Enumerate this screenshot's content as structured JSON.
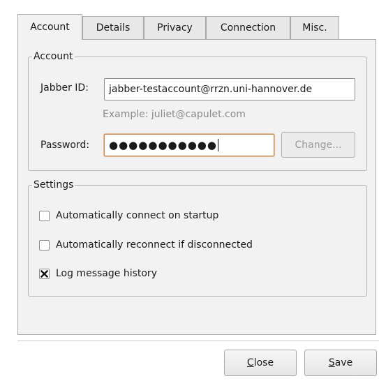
{
  "tabs": [
    {
      "label": "Account",
      "active": true
    },
    {
      "label": "Details",
      "active": false
    },
    {
      "label": "Privacy",
      "active": false
    },
    {
      "label": "Connection",
      "active": false
    },
    {
      "label": "Misc.",
      "active": false
    }
  ],
  "account": {
    "legend": "Account",
    "jabber_label": "Jabber ID:",
    "jabber_value": "jabber-testaccount@rrzn.uni-hannover.de",
    "example": "Example: juliet@capulet.com",
    "password_label": "Password:",
    "password_mask": "●●●●●●●●●●●",
    "change_label": "Change..."
  },
  "settings": {
    "legend": "Settings",
    "options": [
      {
        "label": "Automatically connect on startup",
        "checked": false
      },
      {
        "label": "Automatically reconnect if disconnected",
        "checked": false
      },
      {
        "label": "Log message history",
        "checked": true
      }
    ]
  },
  "buttons": {
    "close_mnemonic": "C",
    "close_rest": "lose",
    "save_mnemonic": "S",
    "save_rest": "ave"
  },
  "icons": {
    "checkbox_checked": "x-check-icon"
  }
}
